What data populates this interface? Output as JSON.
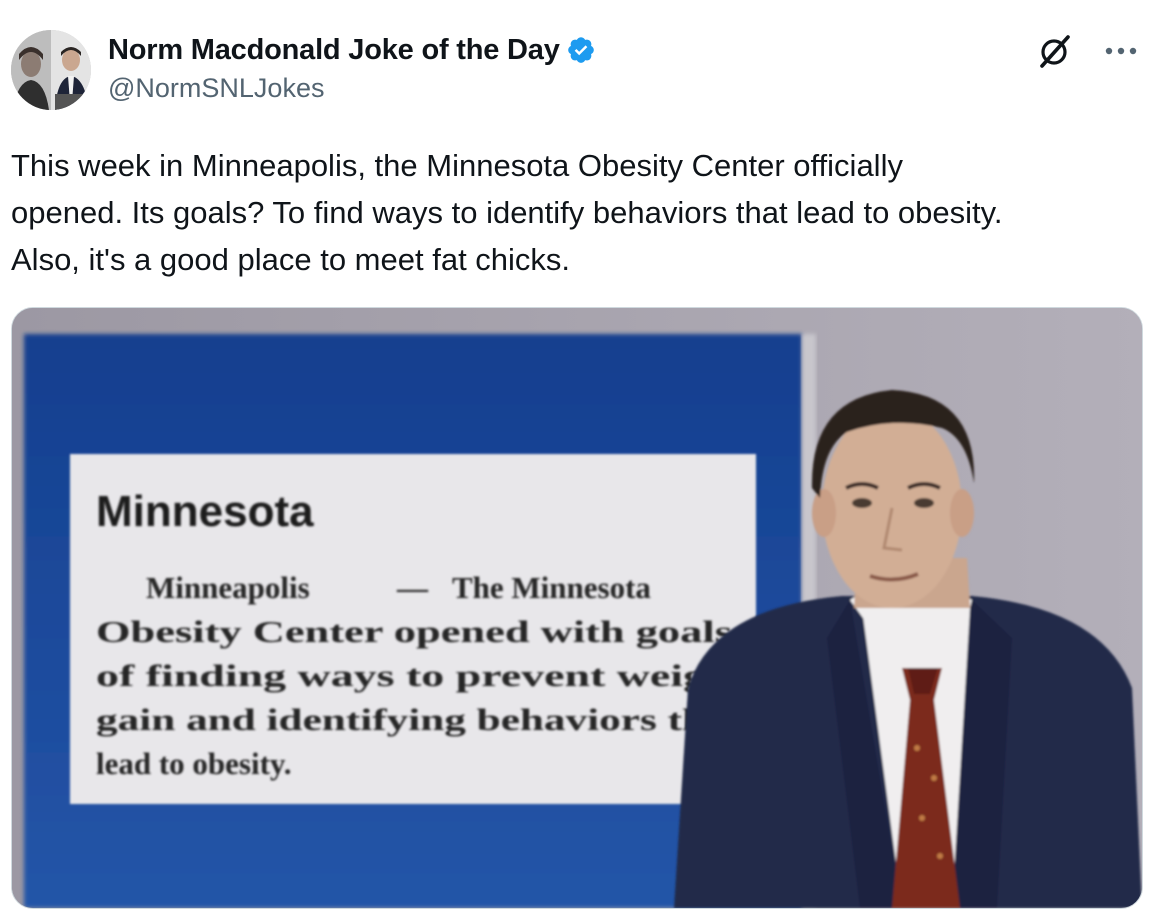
{
  "tweet": {
    "display_name": "Norm Macdonald Joke of the Day",
    "handle": "@NormSNLJokes",
    "text": "This week in Minneapolis, the Minnesota Obesity Center officially\nopened. Its goals? To find ways to identify behaviors that lead to obesity.\nAlso, it's a good place to meet fat chicks.",
    "verified_color": "#1d9bf0",
    "icons": {
      "avatar": "avatar-photo",
      "verified": "verified-badge-icon",
      "grok": "grok-icon",
      "more": "more-options-icon"
    }
  },
  "media": {
    "clipping": {
      "heading": "Minnesota",
      "dateline": "Minneapolis",
      "dash": "—",
      "line1_rest": "The Minnesota",
      "line2": "Obesity Center opened with goals",
      "line3": "of finding ways to prevent weig",
      "line4": "gain and identifying behaviors th",
      "line5": "lead to obesity."
    },
    "colors": {
      "backdrop_blue": "#1f4d9c",
      "wall_grey": "#a8a4ae",
      "paper": "#e9e8ea",
      "suit": "#22294a",
      "tie": "#7a2a1d"
    }
  }
}
